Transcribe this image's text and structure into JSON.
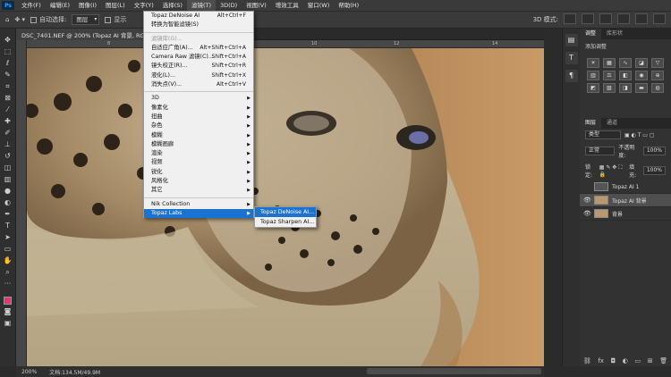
{
  "app": {
    "logo": "Ps"
  },
  "menubar": {
    "items": [
      "文件(F)",
      "编辑(E)",
      "图像(I)",
      "图层(L)",
      "文字(Y)",
      "选择(S)",
      "滤镜(T)",
      "3D(D)",
      "视图(V)",
      "增效工具",
      "窗口(W)",
      "帮助(H)"
    ],
    "active_index": 6
  },
  "options": {
    "auto_select_label": "自动选择:",
    "auto_select_value": "图层",
    "show_transform_label": "显示",
    "mode_3d_label": "3D 模式:"
  },
  "document": {
    "tab_title": "DSC_7401.NEF @ 200% (Topaz AI 背景, RGB/16*)",
    "close": "×"
  },
  "ruler": {
    "marks": [
      "8",
      "10",
      "12",
      "14"
    ]
  },
  "status": {
    "zoom": "200%",
    "doc_info": "文档:134.5M/49.9M"
  },
  "filter_menu": {
    "last_filter": {
      "label": "Topaz DeNoise AI",
      "shortcut": "Alt+Ctrl+F"
    },
    "smart": "转换为智能滤镜(S)",
    "gallery": "滤镜库(G)...",
    "group1": [
      {
        "label": "自适应广角(A)...",
        "shortcut": "Alt+Shift+Ctrl+A"
      },
      {
        "label": "Camera Raw 滤镜(C)...",
        "shortcut": "Shift+Ctrl+A"
      },
      {
        "label": "镜头校正(R)...",
        "shortcut": "Shift+Ctrl+R"
      },
      {
        "label": "液化(L)...",
        "shortcut": "Shift+Ctrl+X"
      },
      {
        "label": "消失点(V)...",
        "shortcut": "Alt+Ctrl+V"
      }
    ],
    "group2": [
      "3D",
      "像素化",
      "扭曲",
      "杂色",
      "模糊",
      "模糊画廊",
      "渲染",
      "视频",
      "锐化",
      "风格化",
      "其它"
    ],
    "group3": [
      "Nik Collection",
      "Topaz Labs"
    ],
    "highlighted": "Topaz Labs"
  },
  "submenu": {
    "items": [
      "Topaz DeNoise AI...",
      "Topaz Sharpen AI..."
    ],
    "highlighted_index": 0
  },
  "panels": {
    "adjust_tabs": [
      "调整",
      "库形状"
    ],
    "add_adjustment": "添加调整",
    "layers_tabs": [
      "图层",
      "通道"
    ],
    "filter_kind": "类型",
    "blend_mode": "正常",
    "opacity_label": "不透明度:",
    "opacity_value": "100%",
    "lock_label": "锁定:",
    "fill_label": "填充:",
    "fill_value": "100%",
    "layers": [
      {
        "name": "Topaz AI 1",
        "visible": false,
        "selected": false
      },
      {
        "name": "Topaz AI 背景",
        "visible": true,
        "selected": true
      },
      {
        "name": "背景",
        "visible": true,
        "selected": false
      }
    ]
  },
  "colors": {
    "foreground": "#e8336d",
    "highlight": "#1a73d1"
  }
}
